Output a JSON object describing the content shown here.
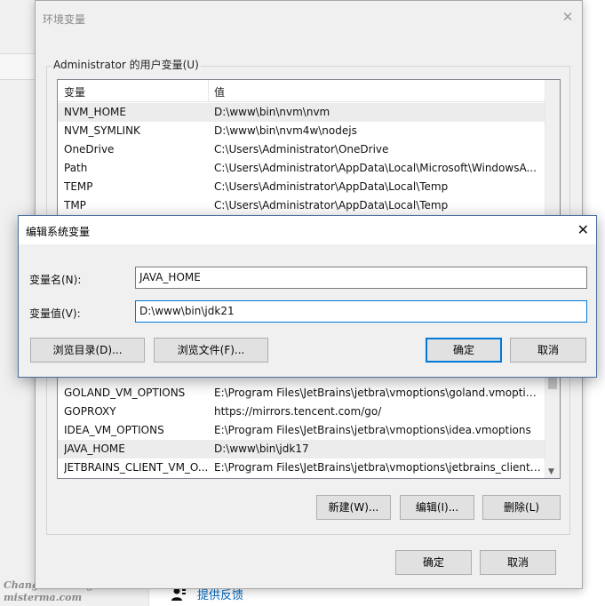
{
  "background": {
    "feedback_label": "提供反馈",
    "watermark_line1": "Changbin's Blog",
    "watermark_line2": "misterma.com"
  },
  "env_window": {
    "title": "环境变量",
    "group_label": "Administrator 的用户变量(U)",
    "columns": {
      "name": "变量",
      "value": "值"
    },
    "rows_top": [
      {
        "name": "NVM_HOME",
        "value": "D:\\www\\bin\\nvm\\nvm",
        "selected": true
      },
      {
        "name": "NVM_SYMLINK",
        "value": "D:\\www\\bin\\nvm4w\\nodejs"
      },
      {
        "name": "OneDrive",
        "value": "C:\\Users\\Administrator\\OneDrive"
      },
      {
        "name": "Path",
        "value": "C:\\Users\\Administrator\\AppData\\Local\\Microsoft\\WindowsA..."
      },
      {
        "name": "TEMP",
        "value": "C:\\Users\\Administrator\\AppData\\Local\\Temp"
      },
      {
        "name": "TMP",
        "value": "C:\\Users\\Administrator\\AppData\\Local\\Temp"
      }
    ],
    "rows_bottom": [
      {
        "name": "GOLAND_VM_OPTIONS",
        "value": "E:\\Program Files\\JetBrains\\jetbra\\vmoptions\\goland.vmoptio..."
      },
      {
        "name": "GOPROXY",
        "value": "https://mirrors.tencent.com/go/"
      },
      {
        "name": "IDEA_VM_OPTIONS",
        "value": "E:\\Program Files\\JetBrains\\jetbra\\vmoptions\\idea.vmoptions"
      },
      {
        "name": "JAVA_HOME",
        "value": "D:\\www\\bin\\jdk17",
        "selected": true
      },
      {
        "name": "JETBRAINS_CLIENT_VM_O...",
        "value": "E:\\Program Files\\JetBrains\\jetbra\\vmoptions\\jetbrains_client.v..."
      }
    ],
    "buttons": {
      "new": "新建(W)...",
      "edit": "编辑(I)...",
      "delete": "删除(L)",
      "ok": "确定",
      "cancel": "取消"
    }
  },
  "edit_dialog": {
    "title": "编辑系统变量",
    "name_label": "变量名(N):",
    "name_value": "JAVA_HOME",
    "value_label": "变量值(V):",
    "value_value": "D:\\www\\bin\\jdk21",
    "buttons": {
      "browse_dir": "浏览目录(D)...",
      "browse_file": "浏览文件(F)...",
      "ok": "确定",
      "cancel": "取消"
    }
  },
  "colors": {
    "accent": "#0078d7",
    "link": "#0067c0"
  }
}
